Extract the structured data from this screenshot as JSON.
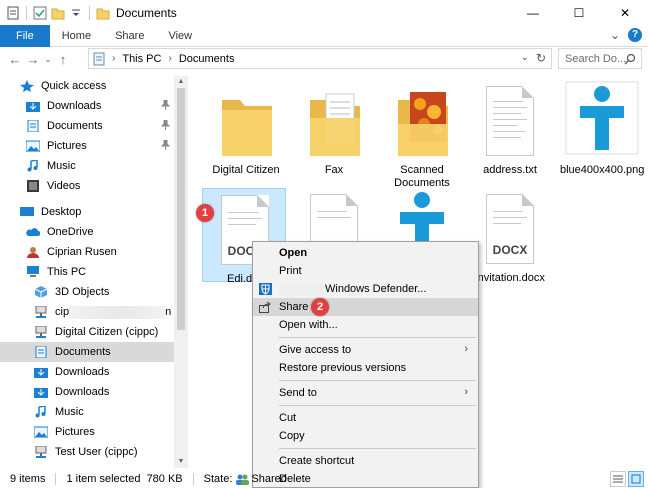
{
  "window": {
    "title": "Documents",
    "controls": {
      "minimize": "—",
      "maximize": "☐",
      "close": "✕"
    }
  },
  "ribbon": {
    "tabs": [
      "File",
      "Home",
      "Share",
      "View"
    ],
    "collapse_glyph": "⌄",
    "help_glyph": "?"
  },
  "address_bar": {
    "back": "←",
    "forward": "→",
    "history": "⌄",
    "up": "↑",
    "crumbs": [
      "This PC",
      "Documents"
    ],
    "dropdown": "⌄",
    "refresh": "↻",
    "search_placeholder": "Search Do..."
  },
  "nav_pane": {
    "items": [
      {
        "label": "Quick access",
        "icon": "star-icon",
        "color": "#1b7fd3",
        "indent": 0,
        "state": "",
        "pinned": false
      },
      {
        "label": "Downloads",
        "icon": "downloads-folder-icon",
        "color": "#1b7fd3",
        "indent": 1,
        "pinned": true
      },
      {
        "label": "Documents",
        "icon": "documents-folder-icon",
        "color": "#1b7fd3",
        "indent": 1,
        "pinned": true
      },
      {
        "label": "Pictures",
        "icon": "pictures-folder-icon",
        "color": "#1b7fd3",
        "indent": 1,
        "pinned": true
      },
      {
        "label": "Music",
        "icon": "music-icon",
        "color": "#1b7fd3",
        "indent": 1,
        "pinned": false
      },
      {
        "label": "Videos",
        "icon": "videos-icon",
        "color": "#3a3a3a",
        "indent": 1,
        "pinned": false
      },
      {
        "label": "Desktop",
        "icon": "desktop-icon",
        "color": "#1b7fd3",
        "indent": 0,
        "pinned": false
      },
      {
        "label": "OneDrive",
        "icon": "onedrive-icon",
        "color": "#1b7fd3",
        "indent": 1,
        "pinned": false
      },
      {
        "label": "Ciprian Rusen",
        "icon": "user-icon",
        "color": "#c07a3a",
        "indent": 1,
        "pinned": false
      },
      {
        "label": "This PC",
        "icon": "this-pc-icon",
        "color": "#1b7fd3",
        "indent": 1,
        "pinned": false
      },
      {
        "label": "3D Objects",
        "icon": "3d-objects-icon",
        "color": "#1b7fd3",
        "indent": 2,
        "pinned": false
      },
      {
        "label": "cip",
        "suffix": "n",
        "icon": "network-drive-icon",
        "color": "#666666",
        "indent": 2,
        "pinned": false,
        "redacted": true
      },
      {
        "label": "Digital Citizen (cippc)",
        "icon": "network-drive-icon",
        "color": "#666666",
        "indent": 2,
        "pinned": false
      },
      {
        "label": "Documents",
        "icon": "documents-folder-icon",
        "color": "#1b7fd3",
        "indent": 2,
        "pinned": false,
        "selected": true
      },
      {
        "label": "Downloads",
        "icon": "downloads-folder-icon",
        "color": "#1b7fd3",
        "indent": 2,
        "pinned": false
      },
      {
        "label": "Downloads",
        "icon": "downloads-folder-icon",
        "color": "#1b7fd3",
        "indent": 2,
        "pinned": false
      },
      {
        "label": "Music",
        "icon": "music-icon",
        "color": "#1b7fd3",
        "indent": 2,
        "pinned": false
      },
      {
        "label": "Pictures",
        "icon": "pictures-folder-icon",
        "color": "#1b7fd3",
        "indent": 2,
        "pinned": false
      },
      {
        "label": "Test User (cippc)",
        "icon": "network-drive-icon",
        "color": "#666666",
        "indent": 2,
        "pinned": false
      }
    ],
    "pin_glyph": "📌"
  },
  "files": [
    {
      "name": "Digital Citizen",
      "kind": "folder"
    },
    {
      "name": "Fax",
      "kind": "folder-docs"
    },
    {
      "name": "Scanned Documents",
      "kind": "folder-photo"
    },
    {
      "name": "address.txt",
      "kind": "text"
    },
    {
      "name": "blue400x400.png",
      "kind": "image-logo"
    },
    {
      "name": "Edi.d",
      "kind": "docx",
      "ext": "DOCX",
      "selected": true
    },
    {
      "name": "",
      "kind": "doc-partial"
    },
    {
      "name": "",
      "kind": "logo-partial"
    },
    {
      "name": "invitation.docx",
      "kind": "docx",
      "ext": "DOCX"
    }
  ],
  "badges": {
    "one": "1",
    "two": "2"
  },
  "context_menu": {
    "items": [
      {
        "label": "Open",
        "bold": true
      },
      {
        "label": "Print"
      },
      {
        "label": "Windows Defender...",
        "icon": "windows-defender-icon",
        "redact_prefix": true
      },
      {
        "label": "Share",
        "icon": "share-icon",
        "highlighted": true
      },
      {
        "label": "Open with..."
      },
      {
        "sep": true
      },
      {
        "label": "Give access to",
        "submenu": true
      },
      {
        "label": "Restore previous versions"
      },
      {
        "sep": true
      },
      {
        "label": "Send to",
        "submenu": true
      },
      {
        "sep": true
      },
      {
        "label": "Cut"
      },
      {
        "label": "Copy"
      },
      {
        "sep": true
      },
      {
        "label": "Create shortcut"
      },
      {
        "label": "Delete"
      }
    ],
    "submenu_glyph": "›"
  },
  "status_bar": {
    "count": "9 items",
    "selection": "1 item selected  780 KB",
    "state_label": "State:",
    "state_value": "Shared"
  },
  "colors": {
    "accent": "#1979ca",
    "folder": "#f7d26a",
    "logo": "#1a9bd7",
    "badge": "#e04040"
  }
}
